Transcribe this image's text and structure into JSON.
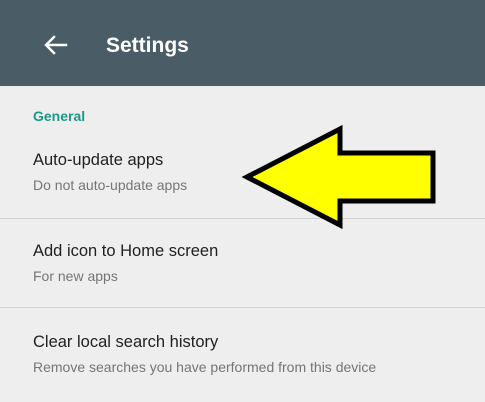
{
  "appbar": {
    "title": "Settings",
    "back_icon": "arrow-back-icon",
    "color": "#4a5d67"
  },
  "section": {
    "title": "General",
    "accent_color": "#1a9a86"
  },
  "items": [
    {
      "title": "Auto-update apps",
      "subtitle": "Do not auto-update apps"
    },
    {
      "title": "Add icon to Home screen",
      "subtitle": "For new apps"
    },
    {
      "title": "Clear local search history",
      "subtitle": "Remove searches you have performed from this device"
    }
  ],
  "annotation": {
    "icon": "yellow-arrow-icon",
    "fill_color": "#ffff00",
    "stroke_color": "#000000",
    "points_to": "Auto-update apps"
  }
}
